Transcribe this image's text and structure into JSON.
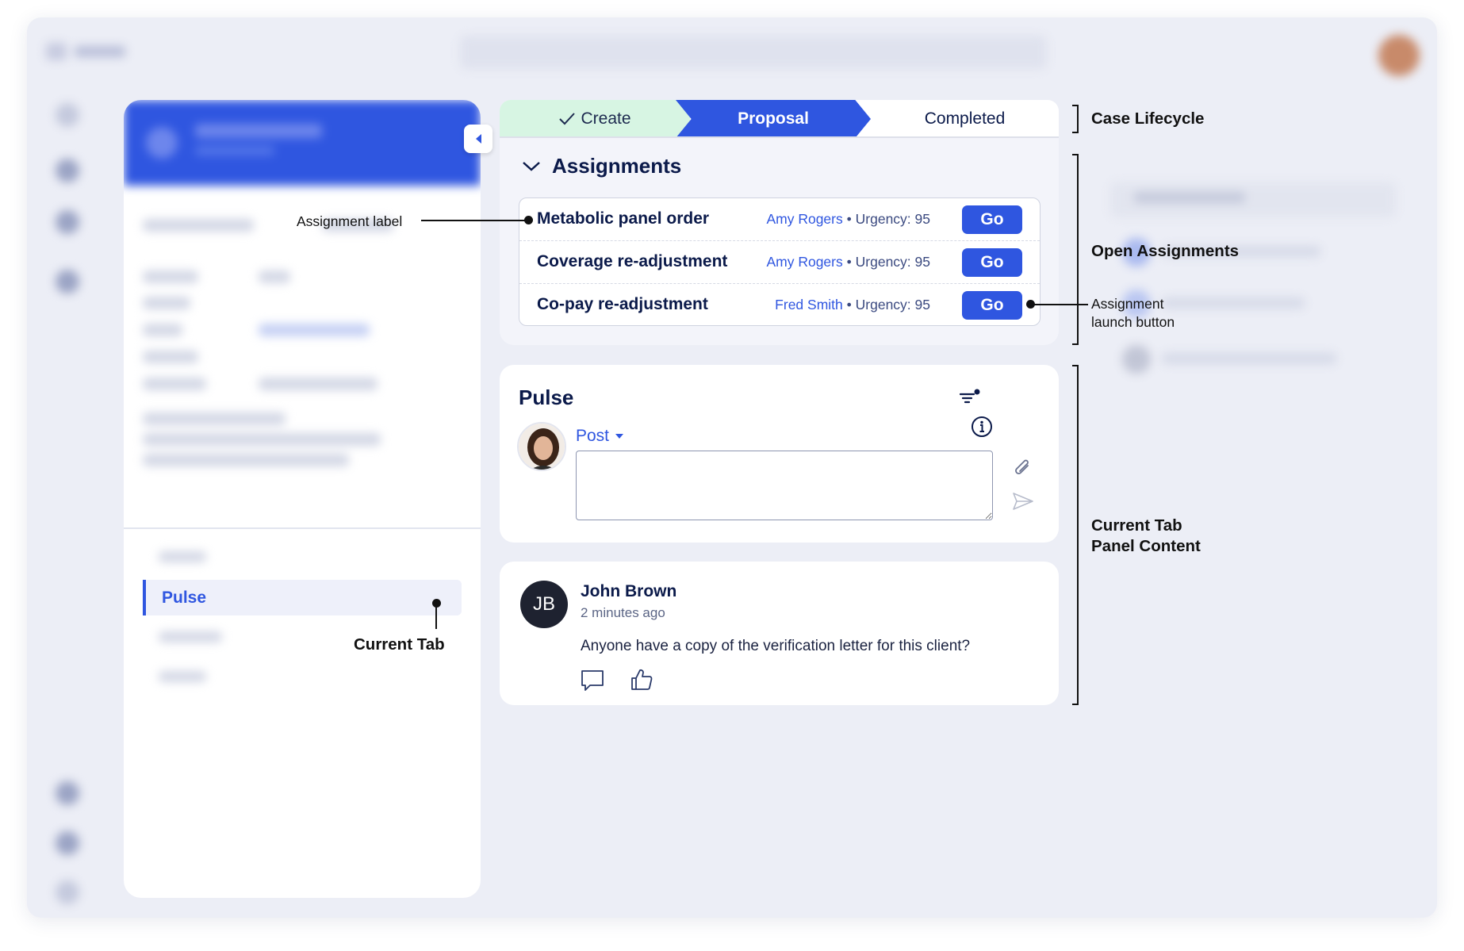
{
  "lifecycle": {
    "stages": [
      {
        "label": "Create",
        "state": "done"
      },
      {
        "label": "Proposal",
        "state": "current"
      },
      {
        "label": "Completed",
        "state": "upcoming"
      }
    ]
  },
  "assignments": {
    "title": "Assignments",
    "rows": [
      {
        "label": "Metabolic panel order",
        "assignee": "Amy Rogers",
        "urgency": "Urgency: 95",
        "button": "Go"
      },
      {
        "label": "Coverage re-adjustment",
        "assignee": "Amy Rogers",
        "urgency": "Urgency: 95",
        "button": "Go"
      },
      {
        "label": "Co-pay re-adjustment",
        "assignee": "Fred Smith",
        "urgency": "Urgency: 95",
        "button": "Go"
      }
    ],
    "separator": "•"
  },
  "pulse": {
    "title": "Pulse",
    "post_type": "Post",
    "input_value": ""
  },
  "comment": {
    "initials": "JB",
    "author": "John Brown",
    "time": "2 minutes ago",
    "text": "Anyone have a copy of the verification letter for this client?"
  },
  "left_panel": {
    "active_tab": "Pulse"
  },
  "annotations": {
    "assignment_label": "Assignment label",
    "current_tab": "Current Tab",
    "case_lifecycle": "Case Lifecycle",
    "open_assignments": "Open Assignments",
    "launch_button_l1": "Assignment",
    "launch_button_l2": "launch button",
    "panel_content_l1": "Current Tab",
    "panel_content_l2": "Panel Content"
  },
  "colors": {
    "primary": "#2f56e0",
    "create_stage": "#d7f5e3",
    "app_background": "#eceef6",
    "text_dark": "#0b1a4a"
  }
}
